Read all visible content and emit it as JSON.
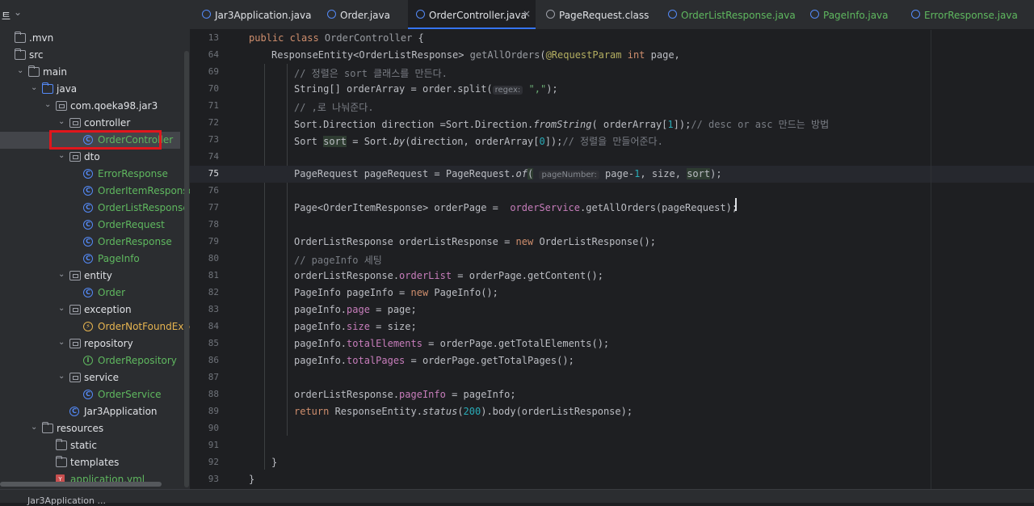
{
  "sidebar": {
    "title": "트",
    "dropdown_icon": "chevron-down-icon",
    "rows": [
      {
        "label": ".mvn",
        "type": "folder"
      },
      {
        "label": "src",
        "type": "folder"
      },
      {
        "label": "main",
        "type": "folder"
      },
      {
        "label": "java",
        "type": "folder-blue"
      },
      {
        "label": "com.qoeka98.jar3",
        "type": "package"
      },
      {
        "label": "controller",
        "type": "package"
      },
      {
        "label": "OrderController",
        "type": "class"
      },
      {
        "label": "dto",
        "type": "package"
      },
      {
        "label": "ErrorResponse",
        "type": "class"
      },
      {
        "label": "OrderItemResponse",
        "type": "class"
      },
      {
        "label": "OrderListResponse",
        "type": "class"
      },
      {
        "label": "OrderRequest",
        "type": "class"
      },
      {
        "label": "OrderResponse",
        "type": "class"
      },
      {
        "label": "PageInfo",
        "type": "class"
      },
      {
        "label": "entity",
        "type": "package"
      },
      {
        "label": "Order",
        "type": "class"
      },
      {
        "label": "exception",
        "type": "package"
      },
      {
        "label": "OrderNotFoundException",
        "type": "exception"
      },
      {
        "label": "repository",
        "type": "package"
      },
      {
        "label": "OrderRepository",
        "type": "interface"
      },
      {
        "label": "service",
        "type": "package"
      },
      {
        "label": "OrderService",
        "type": "class"
      },
      {
        "label": "Jar3Application",
        "type": "app-class"
      },
      {
        "label": "resources",
        "type": "folder"
      },
      {
        "label": "static",
        "type": "folder"
      },
      {
        "label": "templates",
        "type": "folder"
      },
      {
        "label": "application.yml",
        "type": "yml"
      }
    ]
  },
  "tabs": [
    {
      "label": "Jar3Application.java",
      "icon": "class-icon"
    },
    {
      "label": "Order.java",
      "icon": "class-icon"
    },
    {
      "label": "OrderController.java",
      "icon": "class-icon",
      "active": true,
      "close": "×"
    },
    {
      "label": "PageRequest.class",
      "icon": "class-icon"
    },
    {
      "label": "OrderListResponse.java",
      "icon": "class-icon"
    },
    {
      "label": "PageInfo.java",
      "icon": "class-icon"
    },
    {
      "label": "ErrorResponse.java",
      "icon": "class-icon"
    }
  ],
  "editor": {
    "lines": [
      {
        "n": "13"
      },
      {
        "n": "64"
      },
      {
        "n": "69"
      },
      {
        "n": "70"
      },
      {
        "n": "71"
      },
      {
        "n": "72"
      },
      {
        "n": "73"
      },
      {
        "n": "74"
      },
      {
        "n": "75"
      },
      {
        "n": "76"
      },
      {
        "n": "77"
      },
      {
        "n": "78"
      },
      {
        "n": "79"
      },
      {
        "n": "80"
      },
      {
        "n": "81"
      },
      {
        "n": "82"
      },
      {
        "n": "83"
      },
      {
        "n": "84"
      },
      {
        "n": "85"
      },
      {
        "n": "86"
      },
      {
        "n": "87"
      },
      {
        "n": "88"
      },
      {
        "n": "89"
      },
      {
        "n": "90"
      },
      {
        "n": "91"
      },
      {
        "n": "92"
      },
      {
        "n": "93"
      }
    ],
    "t": {
      "l13_kw": "public class ",
      "l13_cls": "OrderController",
      "l13_rest": " {",
      "l64_a": "ResponseEntity<OrderListResponse> ",
      "l64_fn": "getAllOrders",
      "l64_b": "(",
      "l64_ann": "@RequestParam ",
      "l64_kw": "int",
      "l64_c": " page,",
      "l69_cm": "// 정렬은 sort 클래스를 만든다.",
      "l70_a": "String[] orderArray = order.split(",
      "l70_hint": "regex:",
      "l70_str": " \",\"",
      "l70_b": ");",
      "l71_cm": "// ,로 나눠준다.",
      "l72_a": "Sort.Direction direction =Sort.Direction.",
      "l72_it": "fromString",
      "l72_b": "( orderArray[",
      "l72_num": "1",
      "l72_c": "]);",
      "l72_cm": "// desc or asc 만드는 방법",
      "l73_a": "Sort ",
      "l73_var": "sort",
      "l73_b": " = Sort.",
      "l73_it": "by",
      "l73_c": "(direction, orderArray[",
      "l73_num": "0",
      "l73_d": "]);",
      "l73_cm": "// 정렬을 만들어준다.",
      "l75_a": "PageRequest pageRequest = PageRequest.",
      "l75_it": "of",
      "l75_p": "(",
      "l75_hint": "pageNumber:",
      "l75_b": " page-",
      "l75_num": "1",
      "l75_c": ", size, ",
      "l75_sort": "sort",
      "l75_d": ");",
      "l77_a": "Page<OrderItemResponse> orderPage =  ",
      "l77_fld": "orderService",
      "l77_b": ".getAllOrders(pageRequest);",
      "l79_a": "OrderListResponse orderListResponse = ",
      "l79_kw": "new",
      "l79_b": " OrderListResponse();",
      "l80_cm": "// pageInfo 세팅",
      "l81_a": "orderListResponse.",
      "l81_fld": "orderList",
      "l81_b": " = orderPage.getContent();",
      "l82_a": "PageInfo pageInfo = ",
      "l82_kw": "new",
      "l82_b": " PageInfo();",
      "l83_a": "pageInfo.",
      "l83_fld": "page",
      "l83_b": " = page;",
      "l84_a": "pageInfo.",
      "l84_fld": "size",
      "l84_b": " = size;",
      "l85_a": "pageInfo.",
      "l85_fld": "totalElements",
      "l85_b": " = orderPage.getTotalElements();",
      "l86_a": "pageInfo.",
      "l86_fld": "totalPages",
      "l86_b": " = orderPage.getTotalPages();",
      "l88_a": "orderListResponse.",
      "l88_fld": "pageInfo",
      "l88_b": " = pageInfo;",
      "l89_kw": "return",
      "l89_a": " ResponseEntity.",
      "l89_it": "status",
      "l89_b": "(",
      "l89_num": "200",
      "l89_c": ").body(orderListResponse);",
      "l92_a": "}",
      "l93_a": "}"
    }
  },
  "status": {
    "text": "Jar3Application ..."
  }
}
